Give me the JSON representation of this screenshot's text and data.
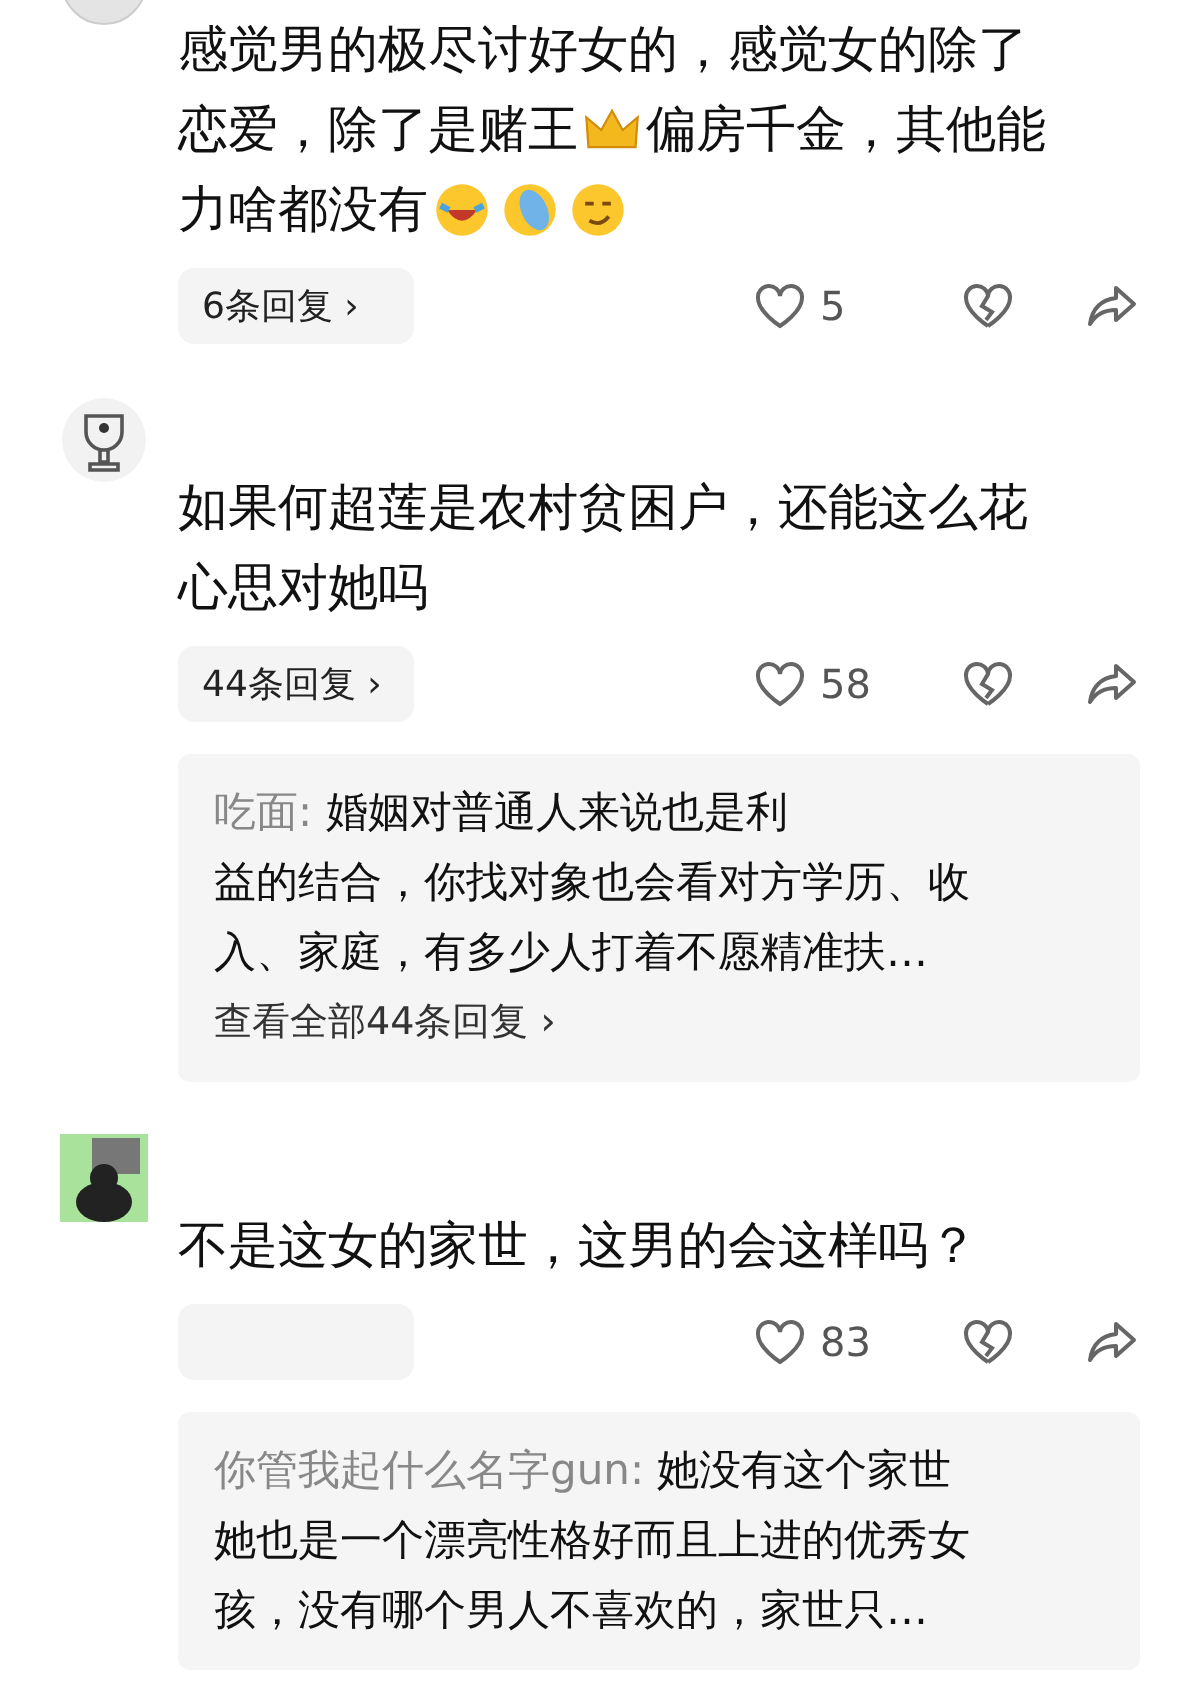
{
  "comments": [
    {
      "avatar": {
        "kind": "plain"
      },
      "lines": [
        [
          {
            "kind": "text",
            "text": "感觉男的极尽讨好女的，感觉女的除了"
          }
        ],
        [
          {
            "kind": "text",
            "text": "恋爱，除了是赌王"
          },
          {
            "kind": "crown"
          },
          {
            "kind": "text",
            "text": "偏房千金，其他能"
          }
        ],
        [
          {
            "kind": "text",
            "text": "力啥都没有"
          },
          {
            "kind": "laugh"
          },
          {
            "kind": "slipper"
          },
          {
            "kind": "smirk"
          }
        ]
      ],
      "replies_button": "6条回复 ›",
      "likes": "5"
    },
    {
      "avatar": {
        "kind": "trophy"
      },
      "lines": [
        [
          {
            "kind": "text",
            "text": "如果何超莲是农村贫困户，还能这么花"
          }
        ],
        [
          {
            "kind": "text",
            "text": "心思对她吗"
          }
        ]
      ],
      "replies_button": "44条回复 ›",
      "likes": "58",
      "reply": {
        "author": "吃面:",
        "lines": [
          "婚姻对普通人来说也是利",
          "益的结合，你找对象也会看对方学历、收",
          "入、家庭，有多少人打着不愿精准扶…"
        ],
        "more": "查看全部44条回复 ›"
      }
    },
    {
      "avatar": {
        "kind": "figure"
      },
      "lines": [
        [
          {
            "kind": "text",
            "text": "不是这女的家世，这男的会这样吗？"
          }
        ]
      ],
      "likes": "83",
      "reply": {
        "author": "你管我起什么名字gun:",
        "lines": [
          "她没有这个家世",
          "她也是一个漂亮性格好而且上进的优秀女",
          "孩，没有哪个男人不喜欢的，家世只…"
        ]
      }
    }
  ]
}
